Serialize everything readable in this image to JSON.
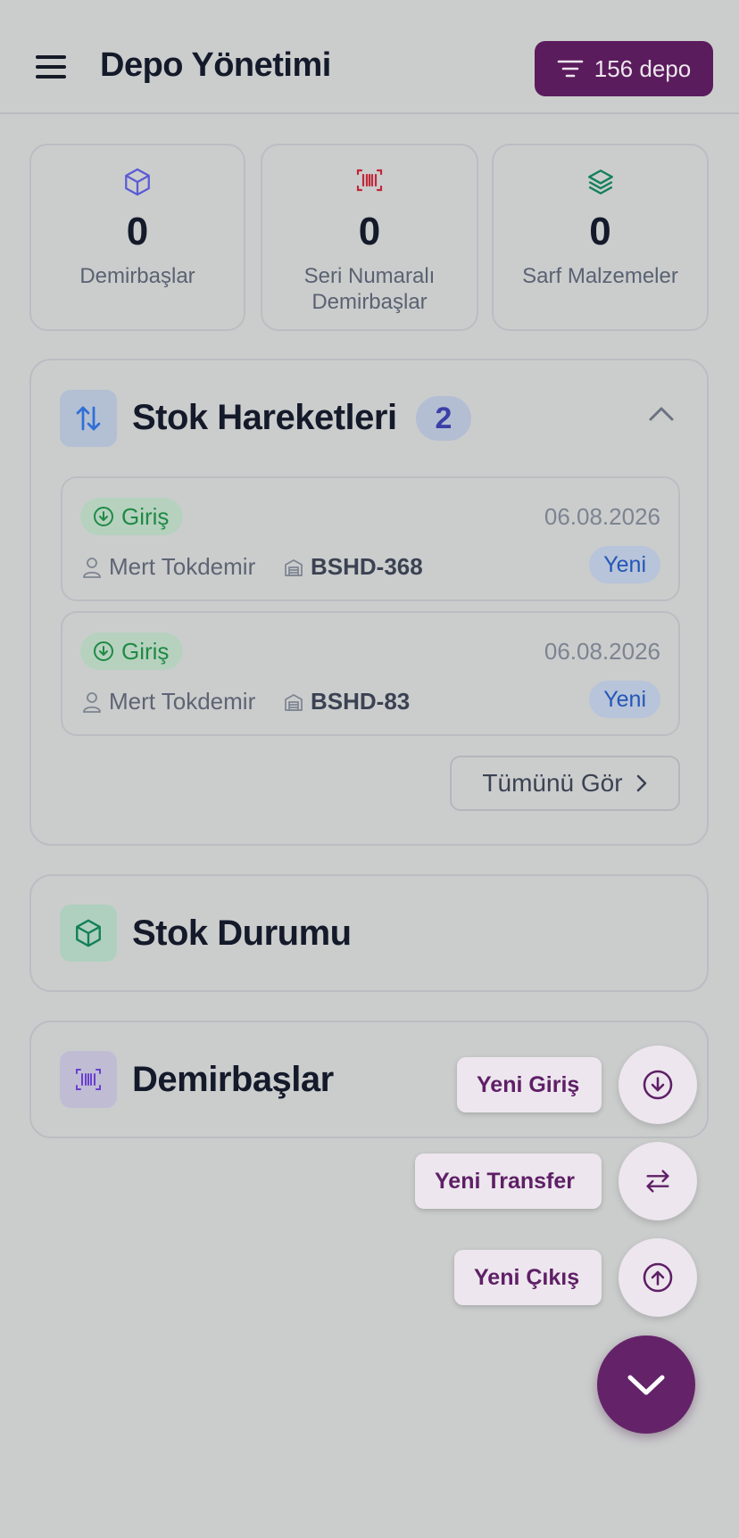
{
  "header": {
    "title": "Depo Yönetimi",
    "depo_button_label": "156 depo"
  },
  "stats": [
    {
      "value": "0",
      "label": "Demirbaşlar",
      "icon": "cube-icon",
      "color": "#5b5bd6"
    },
    {
      "value": "0",
      "label": "Seri Numaralı Demirbaşlar",
      "icon": "barcode-icon",
      "color": "#c0283a"
    },
    {
      "value": "0",
      "label": "Sarf Malzemeler",
      "icon": "layers-icon",
      "color": "#14805a"
    }
  ],
  "stock_movements": {
    "title": "Stok Hareketleri",
    "count": "2",
    "items": [
      {
        "type": "Giriş",
        "date": "06.08.2026",
        "user": "Mert Tokdemir",
        "doc": "BSHD-368",
        "status": "Yeni"
      },
      {
        "type": "Giriş",
        "date": "06.08.2026",
        "user": "Mert Tokdemir",
        "doc": "BSHD-83",
        "status": "Yeni"
      }
    ],
    "see_all_label": "Tümünü Gör"
  },
  "stock_status": {
    "title": "Stok Durumu"
  },
  "fixed_assets": {
    "title": "Demirbaşlar"
  },
  "fab_menu": {
    "new_entry": "Yeni Giriş",
    "new_transfer": "Yeni Transfer",
    "new_exit": "Yeni Çıkış"
  },
  "colors": {
    "primary": "#5a1c5c",
    "entry_green": "#1f8a45",
    "status_blue": "#2456b8"
  }
}
